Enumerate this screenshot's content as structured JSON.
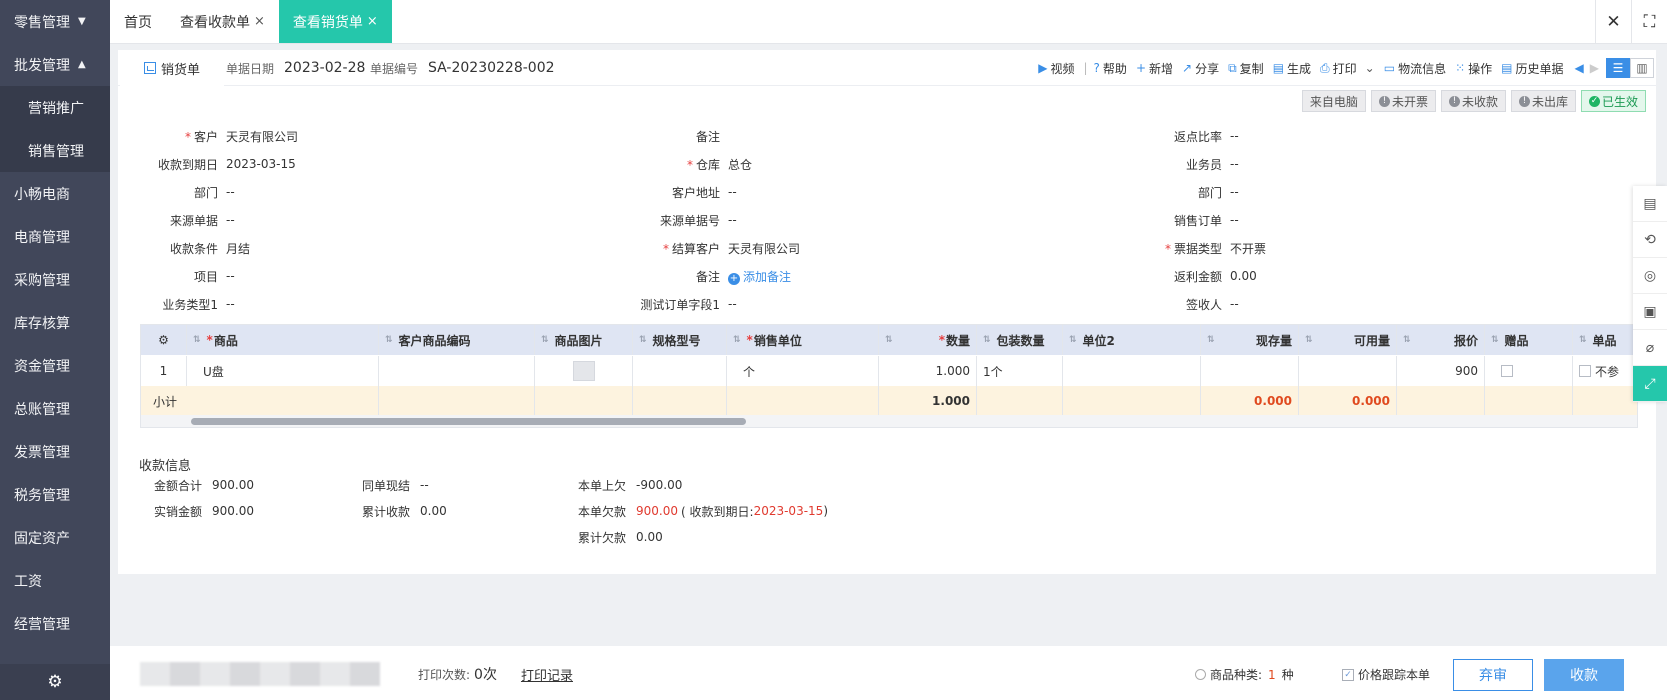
{
  "sidebar": {
    "items": [
      {
        "label": "零售管理",
        "caret": "▼"
      },
      {
        "label": "批发管理",
        "caret": "▲"
      },
      {
        "label": "营销推广"
      },
      {
        "label": "销售管理"
      },
      {
        "label": "小畅电商"
      },
      {
        "label": "电商管理"
      },
      {
        "label": "采购管理"
      },
      {
        "label": "库存核算"
      },
      {
        "label": "资金管理"
      },
      {
        "label": "总账管理"
      },
      {
        "label": "发票管理"
      },
      {
        "label": "税务管理"
      },
      {
        "label": "固定资产"
      },
      {
        "label": "工资"
      },
      {
        "label": "经营管理"
      }
    ]
  },
  "tabs": [
    {
      "label": "首页"
    },
    {
      "label": "查看收款单",
      "close": "×"
    },
    {
      "label": "查看销货单",
      "close": "×"
    }
  ],
  "window": {
    "close": "✕",
    "fullscreen": "⛶"
  },
  "header": {
    "doc_tab": "销货单",
    "date_label": "单据日期",
    "date_value": "2023-02-28",
    "no_label": "单据编号",
    "no_value": "SA-20230228-002"
  },
  "toolbar": {
    "video": "视频",
    "help": "帮助",
    "new": "新增",
    "share": "分享",
    "copy": "复制",
    "generate": "生成",
    "print": "打印",
    "logistics": "物流信息",
    "operate": "操作",
    "history": "历史单据"
  },
  "badges": {
    "source": "来自电脑",
    "invoice": "未开票",
    "receipt": "未收款",
    "outbound": "未出库",
    "effective": "已生效"
  },
  "form": {
    "customer_label": "客户",
    "customer": "天灵有限公司",
    "due_label": "收款到期日",
    "due": "2023-03-15",
    "dept_label": "部门",
    "dept": "--",
    "src_doc_label": "来源单据",
    "src_doc": "--",
    "terms_label": "收款条件",
    "terms": "月结",
    "project_label": "项目",
    "project": "--",
    "biz1_label": "业务类型1",
    "biz1": "--",
    "remark_label": "备注",
    "remark": "",
    "warehouse_label": "仓库",
    "warehouse": "总仓",
    "address_label": "客户地址",
    "address": "--",
    "src_no_label": "来源单据号",
    "src_no": "--",
    "settle_label": "结算客户",
    "settle": "天灵有限公司",
    "remark2_label": "备注",
    "add_remark": "添加备注",
    "test_label": "测试订单字段1",
    "test": "--",
    "rebate_label": "返点比率",
    "rebate": "--",
    "salesman_label": "业务员",
    "salesman": "--",
    "dept2_label": "部门",
    "dept2": "--",
    "order_label": "销售订单",
    "order": "--",
    "bill_type_label": "票据类型",
    "bill_type": "不开票",
    "rebate_amt_label": "返利金额",
    "rebate_amt": "0.00",
    "signer_label": "签收人",
    "signer": "--"
  },
  "table": {
    "headers": {
      "product": "商品",
      "cust_code": "客户商品编码",
      "image": "商品图片",
      "spec": "规格型号",
      "unit": "销售单位",
      "qty": "数量",
      "pack_qty": "包装数量",
      "unit2": "单位2",
      "stock": "现存量",
      "avail": "可用量",
      "price": "报价",
      "gift": "赠品",
      "single": "单品"
    },
    "row": {
      "no": "1",
      "product": "U盘",
      "unit": "个",
      "qty": "1.000",
      "pack_qty": "1个",
      "price": "900",
      "single": "不参"
    },
    "total": {
      "label": "小计",
      "qty": "1.000",
      "stock": "0.000",
      "avail": "0.000"
    }
  },
  "payment": {
    "title": "收款信息",
    "total_label": "金额合计",
    "total": "900.00",
    "actual_label": "实销金额",
    "actual": "900.00",
    "cash_label": "同单现结",
    "cash": "--",
    "acc_recv_label": "累计收款",
    "acc_recv": "0.00",
    "prev_owe_label": "本单上欠",
    "prev_owe": "-900.00",
    "owe_label": "本单欠款",
    "owe": "900.00",
    "owe_note_prefix": "( 收款到期日: ",
    "owe_note_date": "2023-03-15",
    "owe_note_suffix": " )",
    "acc_owe_label": "累计欠款",
    "acc_owe": "0.00"
  },
  "bottom": {
    "print_count_label": "打印次数:",
    "print_count": "0次",
    "print_record": "打印记录",
    "kinds_label": "商品种类:",
    "kinds_count": "1",
    "kinds_unit": "种",
    "follow_price": "价格跟踪本单",
    "discard": "弃审",
    "pay": "收款"
  }
}
